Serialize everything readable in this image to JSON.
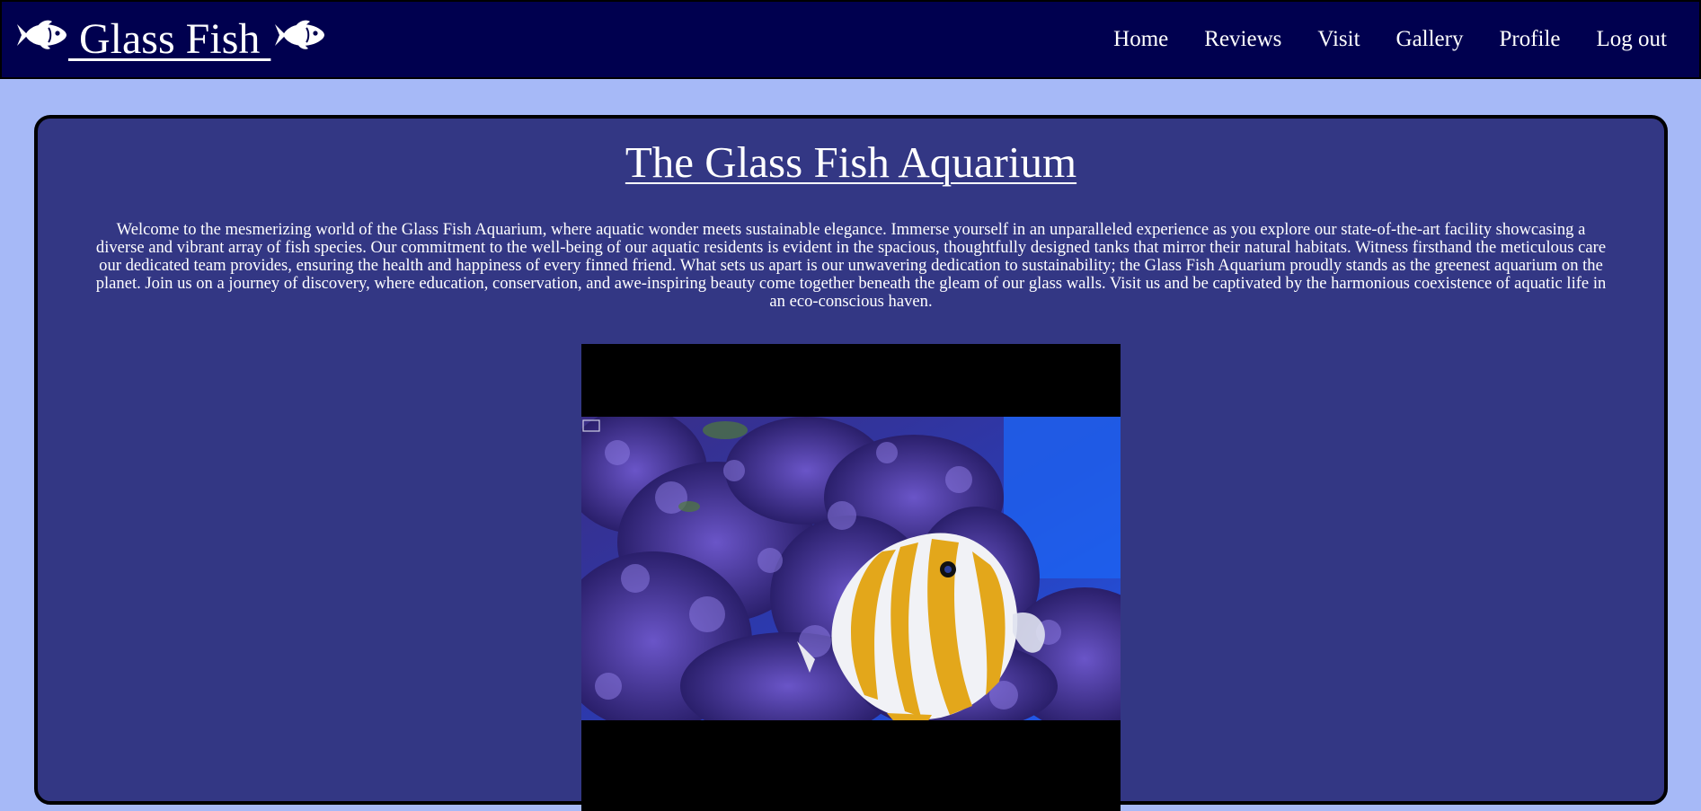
{
  "header": {
    "brand": " Glass Fish ",
    "nav": [
      "Home",
      "Reviews",
      "Visit",
      "Gallery",
      "Profile",
      "Log out"
    ]
  },
  "main": {
    "title": "The Glass Fish Aquarium",
    "intro": "Welcome to the mesmerizing world of the Glass Fish Aquarium, where aquatic wonder meets sustainable elegance. Immerse yourself in an unparalleled experience as you explore our state-of-the-art facility showcasing a diverse and vibrant array of fish species. Our commitment to the well-being of our aquatic residents is evident in the spacious, thoughtfully designed tanks that mirror their natural habitats. Witness firsthand the meticulous care our dedicated team provides, ensuring the health and happiness of every finned friend. What sets us apart is our unwavering dedication to sustainability; the Glass Fish Aquarium proudly stands as the greenest aquarium on the planet. Join us on a journey of discovery, where education, conservation, and awe-inspiring beauty come together beneath the gleam of our glass walls. Visit us and be captivated by the harmonious coexistence of aquatic life in an eco-conscious haven."
  },
  "colors": {
    "page_background": "#a6b9f7",
    "navbar": "#00004f",
    "card": "#333784",
    "text": "#ffffff"
  },
  "icons": [
    "fish-icon",
    "fish-icon"
  ]
}
